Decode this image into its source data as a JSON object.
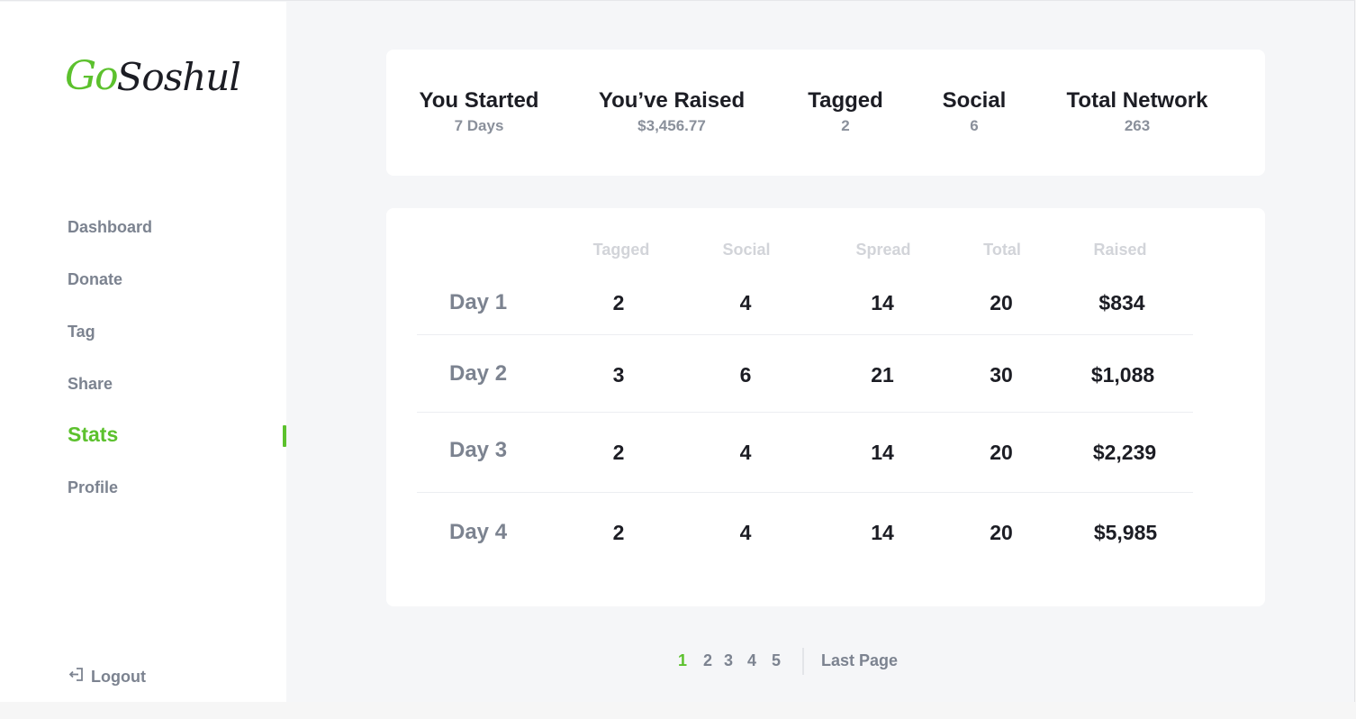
{
  "brand": {
    "logo_part1": "Go",
    "logo_part2": "Soshul",
    "accent_color": "#5cc12d"
  },
  "sidebar": {
    "items": [
      {
        "label": "Dashboard",
        "active": false
      },
      {
        "label": "Donate",
        "active": false
      },
      {
        "label": "Tag",
        "active": false
      },
      {
        "label": "Share",
        "active": false
      },
      {
        "label": "Stats",
        "active": true
      },
      {
        "label": "Profile",
        "active": false
      }
    ],
    "logout_label": "Logout",
    "logout_icon": "logout-icon"
  },
  "summary": [
    {
      "label": "You Started",
      "value": "7 Days"
    },
    {
      "label": "You’ve Raised",
      "value": "$3,456.77"
    },
    {
      "label": "Tagged",
      "value": "2"
    },
    {
      "label": "Social",
      "value": "6"
    },
    {
      "label": "Total Network",
      "value": "263"
    }
  ],
  "table": {
    "headers": [
      "Tagged",
      "Social",
      "Spread",
      "Total",
      "Raised"
    ],
    "rows": [
      {
        "day": "Day 1",
        "cells": [
          "2",
          "4",
          "14",
          "20",
          "$834"
        ]
      },
      {
        "day": "Day 2",
        "cells": [
          "3",
          "6",
          "21",
          "30",
          "$1,088"
        ]
      },
      {
        "day": "Day 3",
        "cells": [
          "2",
          "4",
          "14",
          "20",
          "$2,239"
        ]
      },
      {
        "day": "Day 4",
        "cells": [
          "2",
          "4",
          "14",
          "20",
          "$5,985"
        ]
      }
    ]
  },
  "pagination": {
    "pages": [
      "1",
      "2",
      "3",
      "4",
      "5"
    ],
    "current": "1",
    "last_label": "Last Page"
  }
}
